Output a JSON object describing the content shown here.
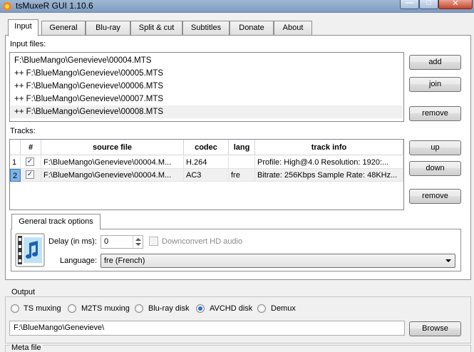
{
  "window": {
    "title": "tsMuxeR GUI 1.10.6",
    "min_glyph": "—",
    "max_glyph": "□",
    "close_glyph": "✕"
  },
  "tabs": [
    "Input",
    "General",
    "Blu-ray",
    "Split & cut",
    "Subtitles",
    "Donate",
    "About"
  ],
  "input": {
    "files_label": "Input files:",
    "files": [
      "F:\\BlueMango\\Genevieve\\00004.MTS",
      "++ F:\\BlueMango\\Genevieve\\00005.MTS",
      "++ F:\\BlueMango\\Genevieve\\00006.MTS",
      "++ F:\\BlueMango\\Genevieve\\00007.MTS",
      "++ F:\\BlueMango\\Genevieve\\00008.MTS"
    ],
    "add_label": "add",
    "join_label": "join",
    "remove_label": "remove"
  },
  "tracks": {
    "label": "Tracks:",
    "columns": [
      "#",
      "source file",
      "codec",
      "lang",
      "track info"
    ],
    "rows": [
      {
        "num": "1",
        "checked": true,
        "source": "F:\\BlueMango\\Genevieve\\00004.M...",
        "codec": "H.264",
        "lang": "",
        "info": "Profile: High@4.0  Resolution: 1920:..."
      },
      {
        "num": "2",
        "checked": true,
        "source": "F:\\BlueMango\\Genevieve\\00004.M...",
        "codec": "AC3",
        "lang": "fre",
        "info": "Bitrate: 256Kbps Sample Rate: 48KHz..."
      }
    ],
    "up_label": "up",
    "down_label": "down",
    "remove_label": "remove"
  },
  "track_options": {
    "tab_label": "General track options",
    "delay_label": "Delay (in ms):",
    "delay_value": "0",
    "downconvert_label": "Downconvert HD audio",
    "language_label": "Language:",
    "language_value": "fre (French)"
  },
  "output": {
    "label": "Output",
    "modes": [
      {
        "label": "TS muxing",
        "selected": false
      },
      {
        "label": "M2TS muxing",
        "selected": false
      },
      {
        "label": "Blu-ray disk",
        "selected": false
      },
      {
        "label": "AVCHD disk",
        "selected": true
      },
      {
        "label": "Demux",
        "selected": false
      }
    ],
    "path": "F:\\BlueMango\\Genevieve\\",
    "browse_label": "Browse"
  },
  "meta": {
    "label": "Meta file"
  }
}
